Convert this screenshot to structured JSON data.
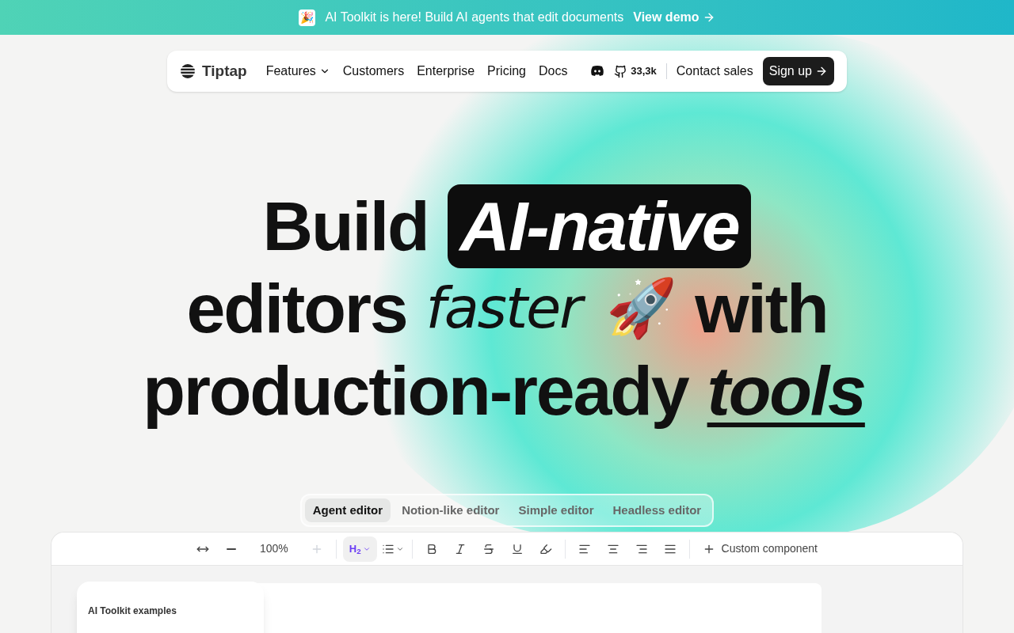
{
  "banner": {
    "emoji": "🎉",
    "text": "AI Toolkit is here! Build AI agents that edit documents",
    "link": "View demo"
  },
  "nav": {
    "brand": "Tiptap",
    "links": [
      {
        "label": "Features",
        "dropdown": true
      },
      {
        "label": "Customers",
        "dropdown": false
      },
      {
        "label": "Enterprise",
        "dropdown": false
      },
      {
        "label": "Pricing",
        "dropdown": false
      },
      {
        "label": "Docs",
        "dropdown": false
      }
    ],
    "stars": "33,3k",
    "contact": "Contact sales",
    "signup": "Sign up"
  },
  "headline": {
    "lines": [
      [
        {
          "text": "Build",
          "kind": "plain"
        },
        {
          "text": "AI-native",
          "kind": "highlight"
        }
      ],
      [
        {
          "text": "editors",
          "kind": "plain"
        },
        {
          "text": "faster",
          "kind": "light"
        },
        {
          "text": "🚀",
          "kind": "emoji"
        },
        {
          "text": "with",
          "kind": "plain"
        }
      ],
      [
        {
          "text": "production-ready",
          "kind": "plain"
        },
        {
          "text": "tools",
          "kind": "underline"
        }
      ]
    ]
  },
  "tabs": [
    {
      "label": "Agent editor",
      "selected": true
    },
    {
      "label": "Notion-like editor",
      "selected": false
    },
    {
      "label": "Simple editor",
      "selected": false
    },
    {
      "label": "Headless editor",
      "selected": false
    }
  ],
  "toolbar": [
    {
      "kind": "resize"
    },
    {
      "kind": "minus"
    },
    {
      "kind": "zoom",
      "text": "100%"
    },
    {
      "kind": "plus",
      "disabled": true
    },
    {
      "kind": "sep"
    },
    {
      "kind": "heading",
      "text": "H$_{2}$",
      "selected": true
    },
    {
      "kind": "list"
    },
    {
      "kind": "sep"
    },
    {
      "kind": "bold"
    },
    {
      "kind": "italic"
    },
    {
      "kind": "strike"
    },
    {
      "kind": "underline"
    },
    {
      "kind": "highlight"
    },
    {
      "kind": "sep"
    },
    {
      "kind": "align-left"
    },
    {
      "kind": "align-center"
    },
    {
      "kind": "align-right"
    },
    {
      "kind": "justify"
    },
    {
      "kind": "sep"
    },
    {
      "kind": "custom",
      "text": "Custom component"
    }
  ],
  "sidebar": {
    "title": "AI Toolkit examples"
  }
}
